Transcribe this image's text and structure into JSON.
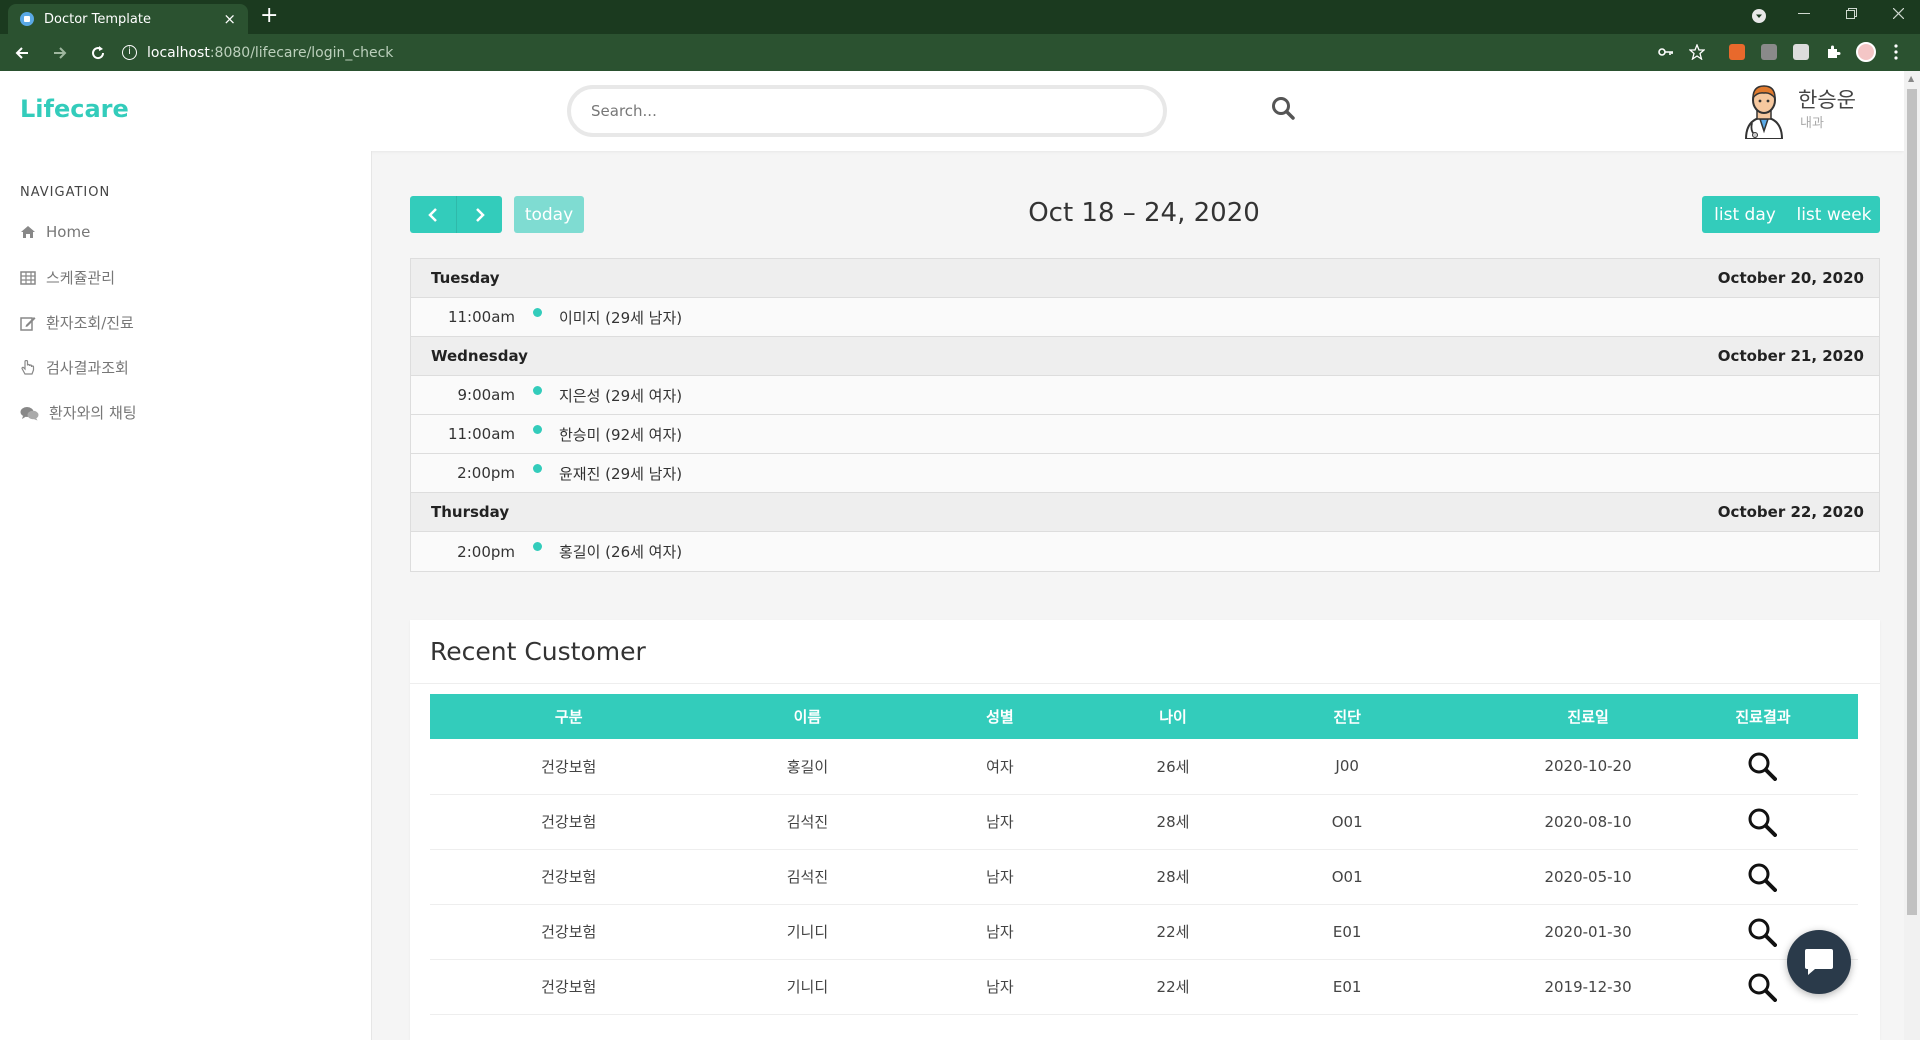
{
  "browser": {
    "tab_title": "Doctor Template",
    "tab_close": "×",
    "new_tab": "+",
    "url_host": "localhost",
    "url_path": ":8080/lifecare/login_check"
  },
  "header": {
    "brand": "Lifecare",
    "search_placeholder": "Search...",
    "user_name": "한승운",
    "user_dept": "내과"
  },
  "sidebar": {
    "heading": "NAVIGATION",
    "items": [
      {
        "label": "Home",
        "icon": "home-icon"
      },
      {
        "label": "스케쥴관리",
        "icon": "table-icon"
      },
      {
        "label": "환자조회/진료",
        "icon": "edit-icon"
      },
      {
        "label": "검사결과조회",
        "icon": "hand-pointer-icon"
      },
      {
        "label": "환자와의 채팅",
        "icon": "chat-icon"
      }
    ]
  },
  "calendar": {
    "prev": "‹",
    "next": "›",
    "today_label": "today",
    "title": "Oct 18 – 24, 2020",
    "list_day_label": "list day",
    "list_week_label": "list week",
    "days": [
      {
        "weekday": "Tuesday",
        "date": "October 20, 2020",
        "events": [
          {
            "time": "11:00am",
            "title": "이미지 (29세 남자)"
          }
        ]
      },
      {
        "weekday": "Wednesday",
        "date": "October 21, 2020",
        "events": [
          {
            "time": "9:00am",
            "title": "지은성 (29세 여자)"
          },
          {
            "time": "11:00am",
            "title": "한승미 (92세 여자)"
          },
          {
            "time": "2:00pm",
            "title": "윤재진 (29세 남자)"
          }
        ]
      },
      {
        "weekday": "Thursday",
        "date": "October 22, 2020",
        "events": [
          {
            "time": "2:00pm",
            "title": "홍길이 (26세 여자)"
          }
        ]
      }
    ]
  },
  "recent": {
    "title": "Recent Customer",
    "columns": [
      "구분",
      "이름",
      "성별",
      "나이",
      "진단",
      "진료일",
      "진료결과"
    ],
    "rows": [
      [
        "건강보험",
        "홍길이",
        "여자",
        "26세",
        "J00",
        "2020-10-20"
      ],
      [
        "건강보험",
        "김석진",
        "남자",
        "28세",
        "O01",
        "2020-08-10"
      ],
      [
        "건강보험",
        "김석진",
        "남자",
        "28세",
        "O01",
        "2020-05-10"
      ],
      [
        "건강보험",
        "기니디",
        "남자",
        "22세",
        "E01",
        "2020-01-30"
      ],
      [
        "건강보험",
        "기니디",
        "남자",
        "22세",
        "E01",
        "2019-12-30"
      ]
    ]
  },
  "colors": {
    "accent": "#33ccbb",
    "browser_frame": "#1b3a1f",
    "toolbar": "#2b5230"
  }
}
